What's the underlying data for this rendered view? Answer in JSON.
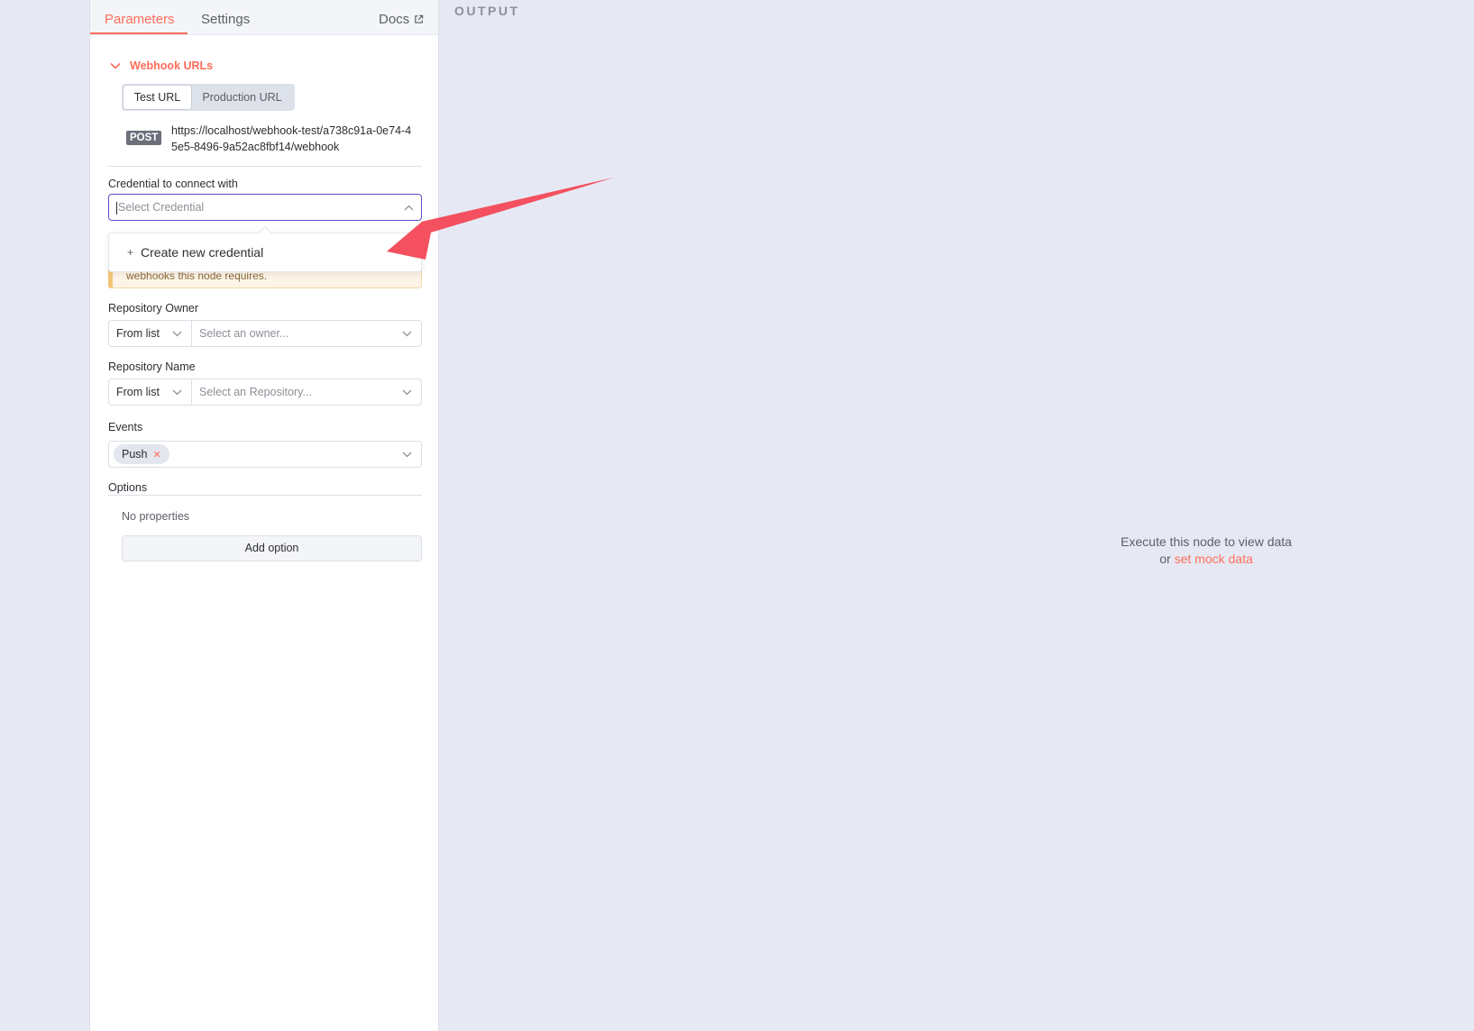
{
  "tabs": {
    "parameters": "Parameters",
    "settings": "Settings",
    "docs": "Docs"
  },
  "webhook": {
    "section_title": "Webhook URLs",
    "test_url_label": "Test URL",
    "production_url_label": "Production URL",
    "method": "POST",
    "url": "https://localhost/webhook-test/a738c91a-0e74-45e5-8496-9a52ac8fbf14/webhook"
  },
  "credential": {
    "label": "Credential to connect with",
    "placeholder": "Select Credential",
    "dropdown_item": "Create new credential",
    "warning_text": "webhooks this node requires."
  },
  "repository_owner": {
    "label": "Repository Owner",
    "mode": "From list",
    "placeholder": "Select an owner..."
  },
  "repository_name": {
    "label": "Repository Name",
    "mode": "From list",
    "placeholder": "Select an Repository..."
  },
  "events": {
    "label": "Events",
    "selected": [
      "Push"
    ]
  },
  "options": {
    "label": "Options",
    "empty": "No properties",
    "add_button": "Add option"
  },
  "output": {
    "title": "OUTPUT",
    "empty_line1": "Execute this node to view data",
    "empty_or": "or",
    "mock_link": "set mock data"
  },
  "colors": {
    "accent": "#ff6d5a",
    "focus_border": "#5b4dc8",
    "annotation_arrow": "#f4505f"
  }
}
